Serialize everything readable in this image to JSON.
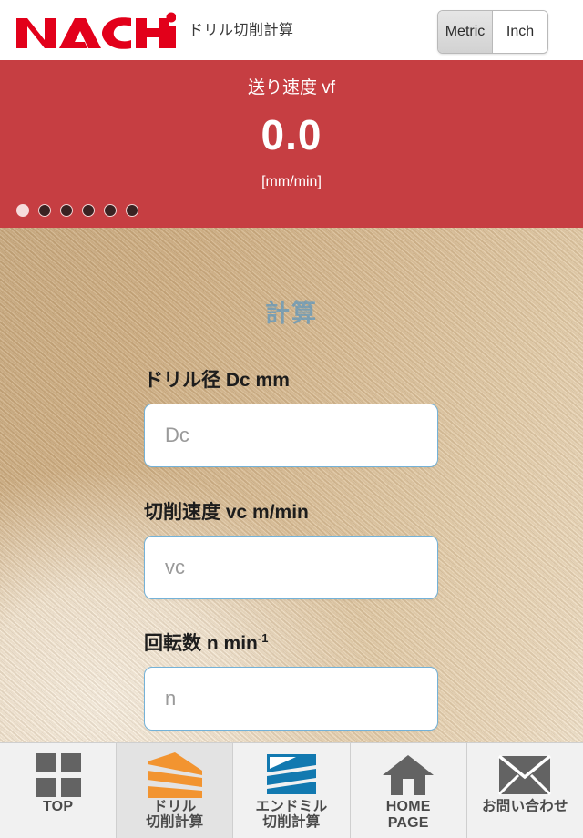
{
  "header": {
    "logo_text": "NACHi",
    "logo_color": "#e2001a",
    "subtitle": "ドリル切削計算",
    "units": {
      "metric_label": "Metric",
      "inch_label": "Inch",
      "selected": "Metric"
    }
  },
  "banner": {
    "title": "送り速度 vf",
    "value": "0.0",
    "unit": "[mm/min]",
    "color": "#c63e42",
    "dots_total": 6,
    "dots_active_index": 0
  },
  "main": {
    "section_title": "計算",
    "fields": [
      {
        "label_jp": "ドリル径",
        "label_sym": "Dc",
        "label_unit": "mm",
        "placeholder": "Dc",
        "value": ""
      },
      {
        "label_jp": "切削速度",
        "label_sym": "vc",
        "label_unit": "m/min",
        "placeholder": "vc",
        "value": ""
      },
      {
        "label_jp": "回転数",
        "label_sym": "n",
        "label_unit": "min",
        "label_sup": "-1",
        "placeholder": "n",
        "value": ""
      }
    ]
  },
  "bottom_nav": {
    "items": [
      {
        "icon": "grid-squares-icon",
        "line1": "TOP",
        "line2": "",
        "active": false,
        "icon_color": "#636363"
      },
      {
        "icon": "drill-icon",
        "line1": "ドリル",
        "line2": "切削計算",
        "active": true,
        "icon_color": "#f29430"
      },
      {
        "icon": "endmill-icon",
        "line1": "エンドミル",
        "line2": "切削計算",
        "active": false,
        "icon_color": "#1279b0"
      },
      {
        "icon": "home-icon",
        "line1": "HOME",
        "line2": "PAGE",
        "active": false,
        "icon_color": "#636363"
      },
      {
        "icon": "envelope-icon",
        "line1": "お問い合わせ",
        "line2": "",
        "active": false,
        "icon_color": "#636363"
      }
    ]
  }
}
